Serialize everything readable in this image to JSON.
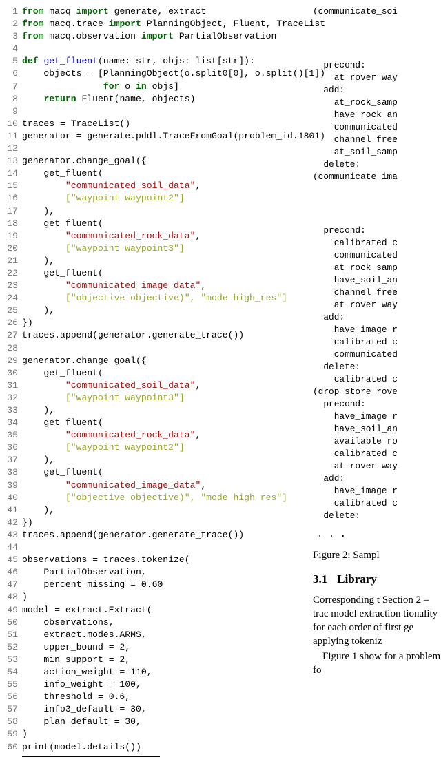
{
  "code": {
    "lines": [
      {
        "n": "1",
        "seg": [
          {
            "c": "kw",
            "t": "from"
          },
          {
            "t": " macq "
          },
          {
            "c": "kw",
            "t": "import"
          },
          {
            "t": " generate, extract"
          }
        ]
      },
      {
        "n": "2",
        "seg": [
          {
            "c": "kw",
            "t": "from"
          },
          {
            "t": " macq.trace "
          },
          {
            "c": "kw",
            "t": "import"
          },
          {
            "t": " PlanningObject, Fluent, TraceList"
          }
        ]
      },
      {
        "n": "3",
        "seg": [
          {
            "c": "kw",
            "t": "from"
          },
          {
            "t": " macq.observation "
          },
          {
            "c": "kw",
            "t": "import"
          },
          {
            "t": " PartialObservation"
          }
        ]
      },
      {
        "n": "4",
        "seg": []
      },
      {
        "n": "5",
        "seg": [
          {
            "c": "kw",
            "t": "def"
          },
          {
            "t": " "
          },
          {
            "c": "fn",
            "t": "get_fluent"
          },
          {
            "t": "(name: str, objs: list[str]):"
          }
        ]
      },
      {
        "n": "6",
        "seg": [
          {
            "t": "    objects = [PlanningObject(o.split0[0], o.split()[1])"
          }
        ]
      },
      {
        "n": "7",
        "seg": [
          {
            "t": "               "
          },
          {
            "c": "kw",
            "t": "for"
          },
          {
            "t": " o "
          },
          {
            "c": "kw",
            "t": "in"
          },
          {
            "t": " objs]"
          }
        ]
      },
      {
        "n": "8",
        "seg": [
          {
            "t": "    "
          },
          {
            "c": "kw",
            "t": "return"
          },
          {
            "t": " Fluent(name, objects)"
          }
        ]
      },
      {
        "n": "9",
        "seg": []
      },
      {
        "n": "10",
        "seg": [
          {
            "t": "traces = TraceList()"
          }
        ]
      },
      {
        "n": "11",
        "seg": [
          {
            "t": "generator = generate.pddl.TraceFromGoal(problem_id.1801)"
          }
        ]
      },
      {
        "n": "12",
        "seg": []
      },
      {
        "n": "13",
        "seg": [
          {
            "t": "generator.change_goal({"
          }
        ]
      },
      {
        "n": "14",
        "seg": [
          {
            "t": "    get_fluent("
          }
        ]
      },
      {
        "n": "15",
        "seg": [
          {
            "t": "        "
          },
          {
            "c": "str",
            "t": "\"communicated_soil_data\""
          },
          {
            "t": ","
          }
        ]
      },
      {
        "n": "16",
        "seg": [
          {
            "t": "        "
          },
          {
            "c": "str2",
            "t": "[\"waypoint waypoint2\"]"
          }
        ]
      },
      {
        "n": "17",
        "seg": [
          {
            "t": "    ),"
          }
        ]
      },
      {
        "n": "18",
        "seg": [
          {
            "t": "    get_fluent("
          }
        ]
      },
      {
        "n": "19",
        "seg": [
          {
            "t": "        "
          },
          {
            "c": "str",
            "t": "\"communicated_rock_data\""
          },
          {
            "t": ","
          }
        ]
      },
      {
        "n": "20",
        "seg": [
          {
            "t": "        "
          },
          {
            "c": "str2",
            "t": "[\"waypoint waypoint3\"]"
          }
        ]
      },
      {
        "n": "21",
        "seg": [
          {
            "t": "    ),"
          }
        ]
      },
      {
        "n": "22",
        "seg": [
          {
            "t": "    get_fluent("
          }
        ]
      },
      {
        "n": "23",
        "seg": [
          {
            "t": "        "
          },
          {
            "c": "str",
            "t": "\"communicated_image_data\""
          },
          {
            "t": ","
          }
        ]
      },
      {
        "n": "24",
        "seg": [
          {
            "t": "        "
          },
          {
            "c": "str2",
            "t": "[\"objective objective)\", \"mode high_res\"]"
          }
        ]
      },
      {
        "n": "25",
        "seg": [
          {
            "t": "    ),"
          }
        ]
      },
      {
        "n": "26",
        "seg": [
          {
            "t": "})"
          }
        ]
      },
      {
        "n": "27",
        "seg": [
          {
            "t": "traces.append(generator.generate_trace())"
          }
        ]
      },
      {
        "n": "28",
        "seg": []
      },
      {
        "n": "29",
        "seg": [
          {
            "t": "generator.change_goal({"
          }
        ]
      },
      {
        "n": "30",
        "seg": [
          {
            "t": "    get_fluent("
          }
        ]
      },
      {
        "n": "31",
        "seg": [
          {
            "t": "        "
          },
          {
            "c": "str",
            "t": "\"communicated_soil_data\""
          },
          {
            "t": ","
          }
        ]
      },
      {
        "n": "32",
        "seg": [
          {
            "t": "        "
          },
          {
            "c": "str2",
            "t": "[\"waypoint waypoint3\"]"
          }
        ]
      },
      {
        "n": "33",
        "seg": [
          {
            "t": "    ),"
          }
        ]
      },
      {
        "n": "34",
        "seg": [
          {
            "t": "    get_fluent("
          }
        ]
      },
      {
        "n": "35",
        "seg": [
          {
            "t": "        "
          },
          {
            "c": "str",
            "t": "\"communicated_rock_data\""
          },
          {
            "t": ","
          }
        ]
      },
      {
        "n": "36",
        "seg": [
          {
            "t": "        "
          },
          {
            "c": "str2",
            "t": "[\"waypoint waypoint2\"]"
          }
        ]
      },
      {
        "n": "37",
        "seg": [
          {
            "t": "    ),"
          }
        ]
      },
      {
        "n": "38",
        "seg": [
          {
            "t": "    get_fluent("
          }
        ]
      },
      {
        "n": "39",
        "seg": [
          {
            "t": "        "
          },
          {
            "c": "str",
            "t": "\"communicated_image_data\""
          },
          {
            "t": ","
          }
        ]
      },
      {
        "n": "40",
        "seg": [
          {
            "t": "        "
          },
          {
            "c": "str2",
            "t": "[\"objective objective)\", \"mode high_res\"]"
          }
        ]
      },
      {
        "n": "41",
        "seg": [
          {
            "t": "    ),"
          }
        ]
      },
      {
        "n": "42",
        "seg": [
          {
            "t": "})"
          }
        ]
      },
      {
        "n": "43",
        "seg": [
          {
            "t": "traces.append(generator.generate_trace())"
          }
        ]
      },
      {
        "n": "44",
        "seg": []
      },
      {
        "n": "45",
        "seg": [
          {
            "t": "observations = traces.tokenize("
          }
        ]
      },
      {
        "n": "46",
        "seg": [
          {
            "t": "    PartialObservation,"
          }
        ]
      },
      {
        "n": "47",
        "seg": [
          {
            "t": "    percent_missing = 0.60"
          }
        ]
      },
      {
        "n": "48",
        "seg": [
          {
            "t": ")"
          }
        ]
      },
      {
        "n": "49",
        "seg": [
          {
            "t": "model = extract.Extract("
          }
        ]
      },
      {
        "n": "50",
        "seg": [
          {
            "t": "    observations,"
          }
        ]
      },
      {
        "n": "51",
        "seg": [
          {
            "t": "    extract.modes.ARMS,"
          }
        ]
      },
      {
        "n": "52",
        "seg": [
          {
            "t": "    upper_bound = 2,"
          }
        ]
      },
      {
        "n": "53",
        "seg": [
          {
            "t": "    min_support = 2,"
          }
        ]
      },
      {
        "n": "54",
        "seg": [
          {
            "t": "    action_weight = 110,"
          }
        ]
      },
      {
        "n": "55",
        "seg": [
          {
            "t": "    info_weight = 100,"
          }
        ]
      },
      {
        "n": "56",
        "seg": [
          {
            "t": "    threshold = 0.6,"
          }
        ]
      },
      {
        "n": "57",
        "seg": [
          {
            "t": "    info3_default = 30,"
          }
        ]
      },
      {
        "n": "58",
        "seg": [
          {
            "t": "    plan_default = 30,"
          }
        ]
      },
      {
        "n": "59",
        "seg": [
          {
            "t": ")"
          }
        ]
      },
      {
        "n": "60",
        "seg": [
          {
            "t": "print(model.details())"
          }
        ]
      }
    ]
  },
  "right_top_line": "(communicate_soi",
  "right_block1": "  precond:\n    at rover way\n  add:\n    at_rock_samp\n    have_rock_an\n    communicated\n    channel_free\n    at_soil_samp\n  delete:\n(communicate_ima",
  "right_block2": "  precond:\n    calibrated c\n    communicated\n    at_rock_samp\n    have_soil_an\n    channel_free\n    at rover way\n  add:\n    have_image r\n    calibrated c\n    communicated\n  delete:\n    calibrated c\n(drop store rove\n  precond:\n    have_image r\n    have_soil_an\n    available ro\n    calibrated c\n    at rover way\n  add:\n    have_image r\n    calibrated c\n  delete:",
  "dots": ". . .",
  "fig_caption": "Figure 2: Sampl",
  "sec_no": "3.1",
  "sec_title": "Library ",
  "body_p1": "Corresponding t Section 2 – trac model extraction tionality for each order of first ge applying tokeniz",
  "body_p2": "Figure 1 show for a problem fo"
}
